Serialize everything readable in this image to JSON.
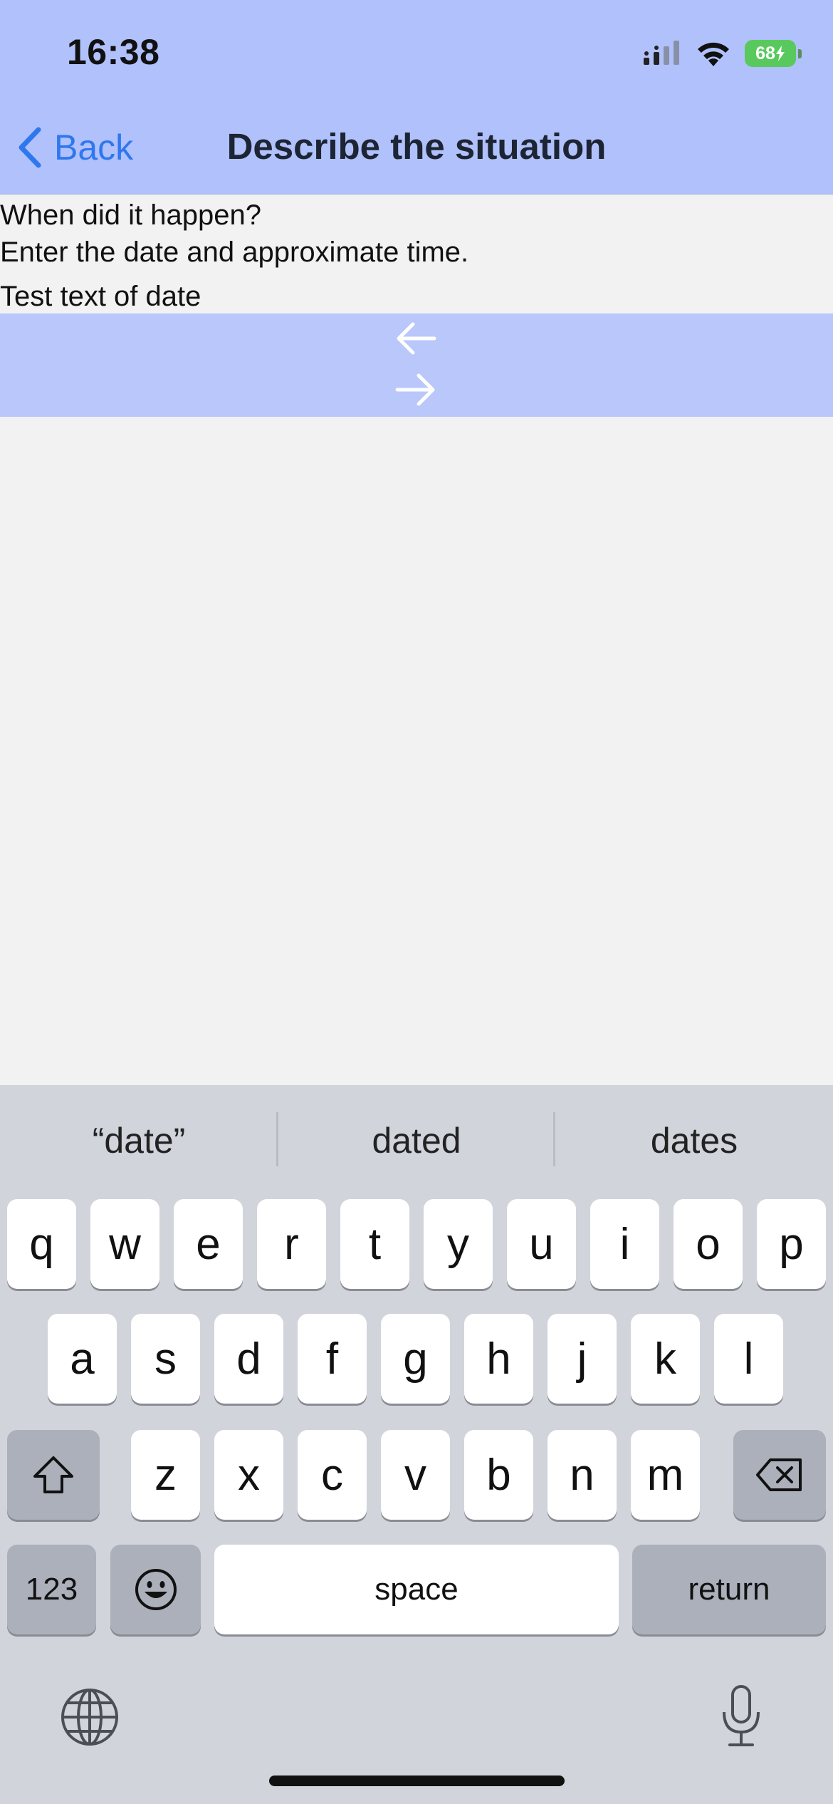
{
  "status_bar": {
    "time": "16:38",
    "battery": "68"
  },
  "nav": {
    "back_label": "Back",
    "title": "Describe the situation"
  },
  "content": {
    "question_line1": "When did it happen?",
    "question_line2": "Enter the date and approximate time.",
    "answer_text": "Test text of date"
  },
  "keyboard": {
    "suggestions": [
      "“date”",
      "dated",
      "dates"
    ],
    "row1": [
      "q",
      "w",
      "e",
      "r",
      "t",
      "y",
      "u",
      "i",
      "o",
      "p"
    ],
    "row2": [
      "a",
      "s",
      "d",
      "f",
      "g",
      "h",
      "j",
      "k",
      "l"
    ],
    "row3": [
      "z",
      "x",
      "c",
      "v",
      "b",
      "n",
      "m"
    ],
    "numbers_label": "123",
    "space_label": "space",
    "return_label": "return"
  },
  "colors": {
    "header_bg": "#b0c1fb",
    "arrow_bar_bg": "#b9c7fa",
    "accent": "#2f77ee",
    "battery": "#59c95e",
    "keyboard_bg": "#d1d4db"
  },
  "icons": [
    "signal-icon",
    "wifi-icon",
    "battery-icon",
    "chevron-left-icon",
    "arrow-left-icon",
    "arrow-right-icon",
    "shift-icon",
    "backspace-icon",
    "emoji-icon",
    "globe-icon",
    "microphone-icon"
  ]
}
